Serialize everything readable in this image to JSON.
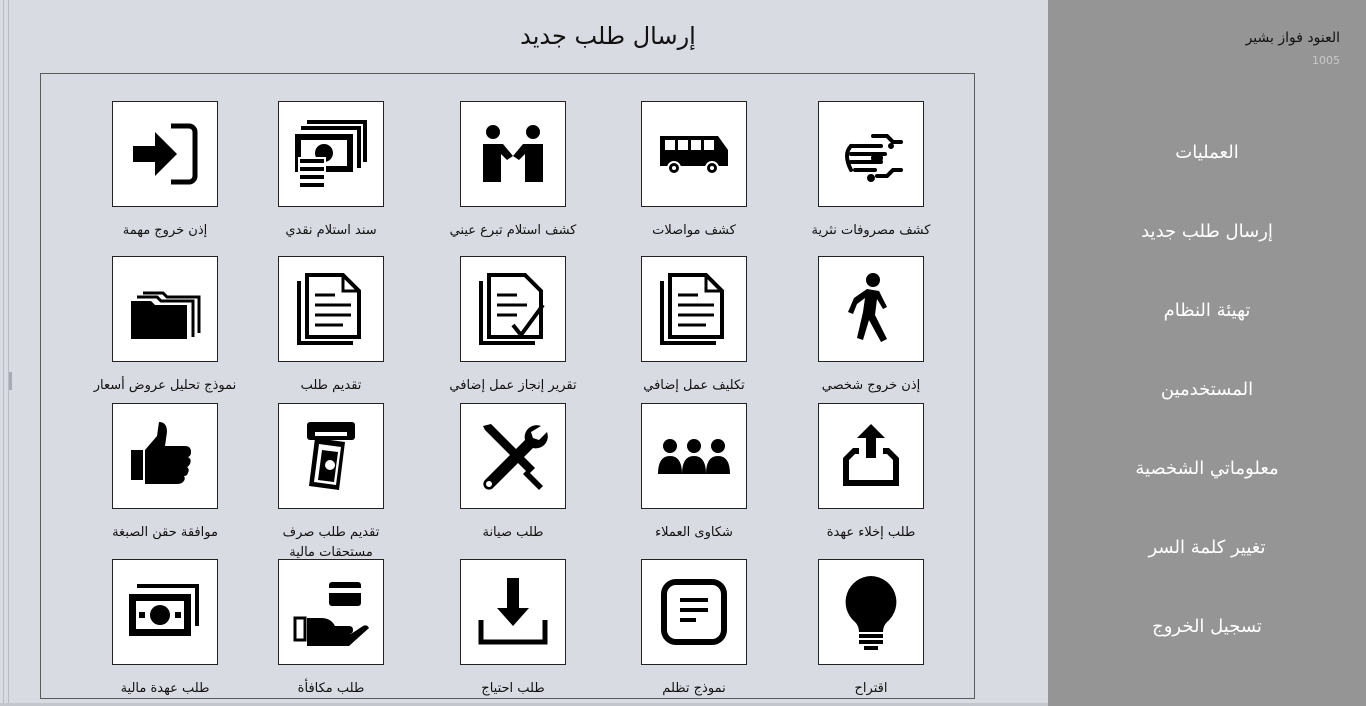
{
  "header": {
    "title": "إرسال طلب جديد"
  },
  "user": {
    "name": "العنود فواز بشير",
    "id": "1005"
  },
  "nav": [
    {
      "label": "العمليات"
    },
    {
      "label": "إرسال طلب جديد"
    },
    {
      "label": "تهيئة النظام"
    },
    {
      "label": "المستخدمين"
    },
    {
      "label": "معلوماتي الشخصية"
    },
    {
      "label": "تغيير كلمة السر"
    },
    {
      "label": "تسجيل الخروج"
    }
  ],
  "tiles": [
    {
      "label": "كشف مصروفات نثرية",
      "icon": "hand-coins-icon"
    },
    {
      "label": "كشف مواصلات",
      "icon": "bus-icon"
    },
    {
      "label": "كشف استلام تبرع عيني",
      "icon": "handshake-icon"
    },
    {
      "label": "سند استلام نقدي",
      "icon": "cash-stack-icon"
    },
    {
      "label": "إذن خروج مهمة",
      "icon": "sign-in-icon"
    },
    {
      "label": "إذن خروج شخصي",
      "icon": "walking-person-icon"
    },
    {
      "label": "تكليف عمل إضافي",
      "icon": "document-stack-icon"
    },
    {
      "label": "تقرير إنجاز عمل إضافي",
      "icon": "document-check-icon"
    },
    {
      "label": "تقديم طلب",
      "icon": "document-stack-icon"
    },
    {
      "label": "نموذج تحليل عروض أسعار",
      "icon": "folders-icon"
    },
    {
      "label": "طلب إخلاء عهدة",
      "icon": "outbox-upload-icon"
    },
    {
      "label": "شكاوى العملاء",
      "icon": "customers-group-icon"
    },
    {
      "label": "طلب صيانة",
      "icon": "tools-icon"
    },
    {
      "label": "تقديم طلب صرف مستحقات مالية",
      "icon": "atm-cash-icon"
    },
    {
      "label": "موافقة حقن الصبغة",
      "icon": "thumbs-up-icon"
    },
    {
      "label": "اقتراح",
      "icon": "lightbulb-icon"
    },
    {
      "label": "نموذج تظلم",
      "icon": "note-icon"
    },
    {
      "label": "طلب احتياج",
      "icon": "download-tray-icon"
    },
    {
      "label": "طلب مكافأة",
      "icon": "hand-card-icon"
    },
    {
      "label": "طلب عهدة مالية",
      "icon": "banknote-icon"
    }
  ]
}
